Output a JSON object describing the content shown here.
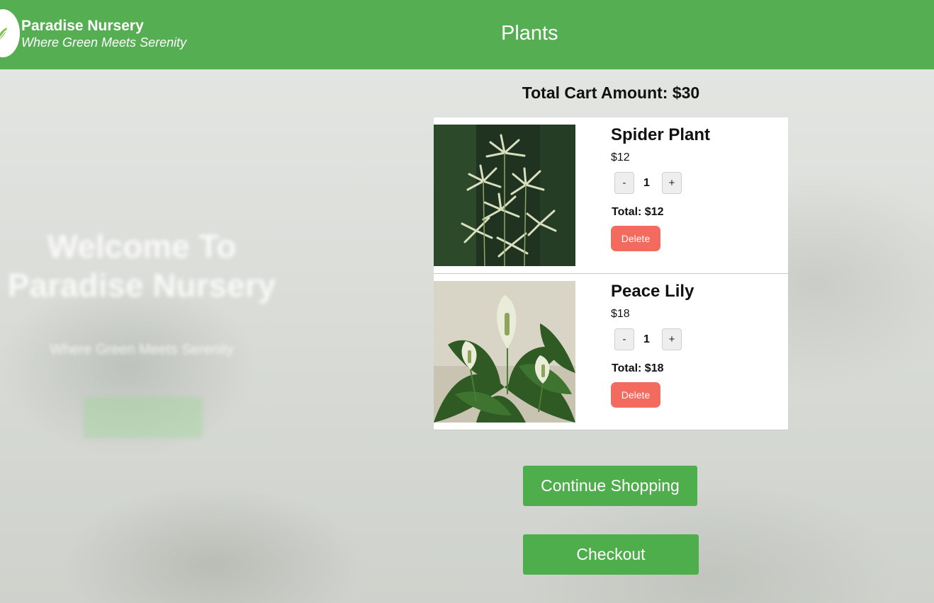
{
  "header": {
    "brand_name": "Paradise Nursery",
    "brand_tagline": "Where Green Meets Serenity",
    "nav_plants": "Plants"
  },
  "background": {
    "welcome_line1": "Welcome To",
    "welcome_line2": "Paradise Nursery",
    "subtitle": "Where Green Meets Serenity",
    "button_label": "Get Started"
  },
  "cart": {
    "total_label": "Total Cart Amount: $30",
    "items": [
      {
        "name": "Spider Plant",
        "price": "$12",
        "minus": "-",
        "quantity": "1",
        "plus": "+",
        "subtotal": "Total: $12",
        "delete_label": "Delete"
      },
      {
        "name": "Peace Lily",
        "price": "$18",
        "minus": "-",
        "quantity": "1",
        "plus": "+",
        "subtotal": "Total: $18",
        "delete_label": "Delete"
      }
    ],
    "continue_label": "Continue Shopping",
    "checkout_label": "Checkout"
  },
  "colors": {
    "header_green": "#56ae53",
    "button_green": "#4eae4b",
    "delete_red": "#f36a5f"
  }
}
